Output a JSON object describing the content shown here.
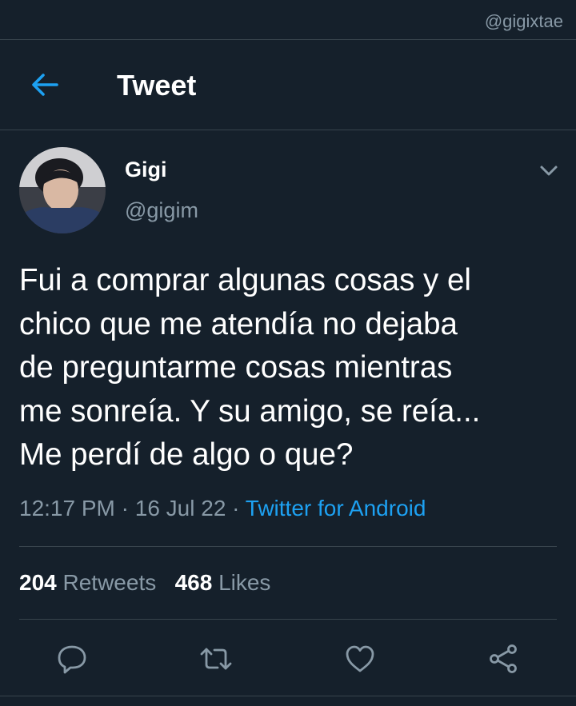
{
  "watermark": "@gigixtae",
  "header": {
    "title": "Tweet",
    "back_icon": "arrow-left-icon"
  },
  "tweet": {
    "author_name": "Gigi",
    "author_handle": "@gigim",
    "text_lines": [
      "Fui a comprar algunas cosas y el",
      "chico que me atendía no dejaba",
      "de preguntarme cosas mientras",
      "me sonreía. Y su amigo, se reía...",
      "Me perdí de algo o que?"
    ],
    "time": "12:17 PM",
    "date": "16 Jul 22",
    "separator": "·",
    "source": "Twitter for Android"
  },
  "stats": {
    "retweets_count": "204",
    "retweets_label": "Retweets",
    "likes_count": "468",
    "likes_label": "Likes"
  },
  "actions": [
    "reply-icon",
    "retweet-icon",
    "like-icon",
    "share-icon"
  ],
  "colors": {
    "background": "#15202b",
    "accent": "#1da1f2",
    "secondary_text": "#8899a6",
    "divider": "#38444d"
  }
}
